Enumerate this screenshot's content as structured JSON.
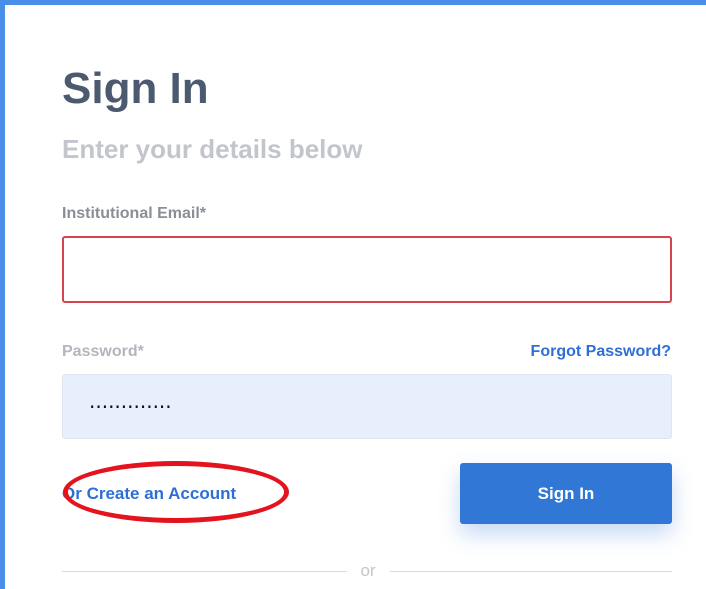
{
  "signin": {
    "title": "Sign In",
    "subtitle": "Enter your details below",
    "email_label": "Institutional Email*",
    "email_value": "",
    "password_label": "Password*",
    "password_value": "·············",
    "forgot_label": "Forgot Password?",
    "or_prefix": "Or",
    "create_account_label": "Create an Account",
    "button_label": "Sign In",
    "divider_text": "or"
  },
  "colors": {
    "accent": "#3178d6",
    "error_border": "#d9434e",
    "annotation": "#e3141d",
    "title": "#4b5a6f"
  }
}
